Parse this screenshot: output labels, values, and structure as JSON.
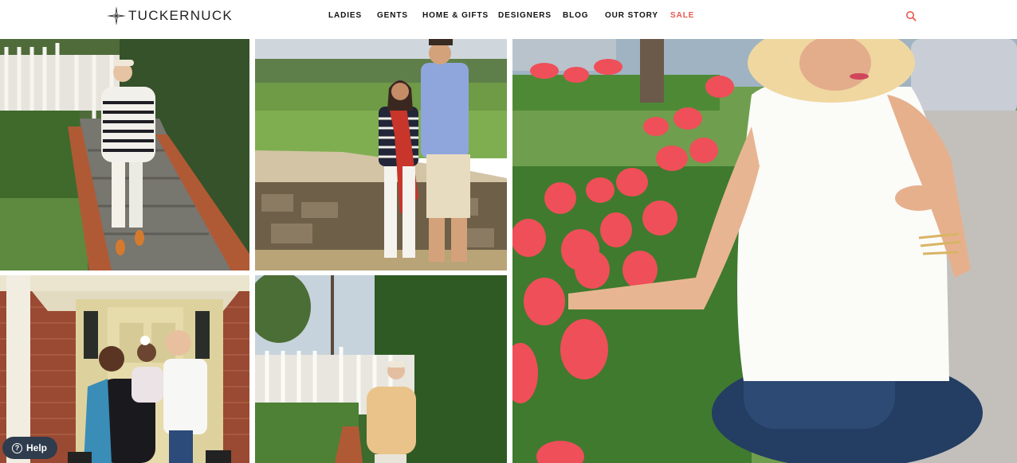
{
  "brand": {
    "name": "TUCKERNUCK",
    "logo_icon": "compass-star-icon"
  },
  "nav": {
    "items": [
      {
        "label": "LADIES"
      },
      {
        "label": "GENTS"
      },
      {
        "label": "HOME & GIFTS"
      },
      {
        "label": "DESIGNERS"
      },
      {
        "label": "BLOG"
      },
      {
        "label": "OUR STORY"
      },
      {
        "label": "SALE"
      }
    ]
  },
  "search": {
    "icon": "search-icon"
  },
  "colors": {
    "sale": "#e8584f",
    "help_bg": "#2f3c4d",
    "text": "#111111"
  },
  "gallery": {
    "photos": [
      {
        "description": "woman in striped sweater on garden steps"
      },
      {
        "description": "couple posing on stone wall overlooking valley"
      },
      {
        "description": "woman in white top crouching by pink tulips"
      },
      {
        "description": "family in front of yellow door"
      },
      {
        "description": "woman in tan sweater by white garden gate"
      }
    ]
  },
  "help": {
    "label": "Help",
    "icon": "question-circle-icon"
  }
}
